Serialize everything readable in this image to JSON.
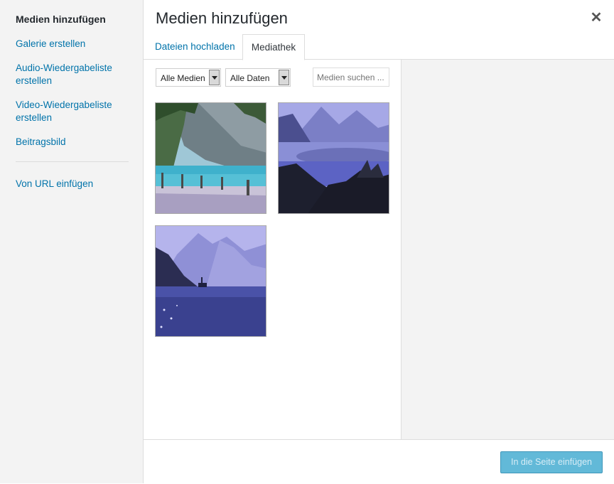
{
  "sidebar": {
    "title": "Medien hinzufügen",
    "items": [
      {
        "label": "Galerie erstellen"
      },
      {
        "label": "Audio-Wiedergabeliste erstellen"
      },
      {
        "label": "Video-Wiedergabeliste erstellen"
      },
      {
        "label": "Beitragsbild"
      }
    ],
    "url_item": "Von URL einfügen"
  },
  "header": {
    "title": "Medien hinzufügen",
    "close_glyph": "✕"
  },
  "tabs": [
    {
      "label": "Dateien hochladen",
      "active": false
    },
    {
      "label": "Mediathek",
      "active": true
    }
  ],
  "filters": {
    "media_type": "Alle Medien",
    "date": "Alle Daten",
    "search_placeholder": "Medien suchen ..."
  },
  "footer": {
    "insert_label": "In die Seite einfügen"
  },
  "colors": {
    "link": "#0073aa",
    "button": "#2ea2cc"
  }
}
